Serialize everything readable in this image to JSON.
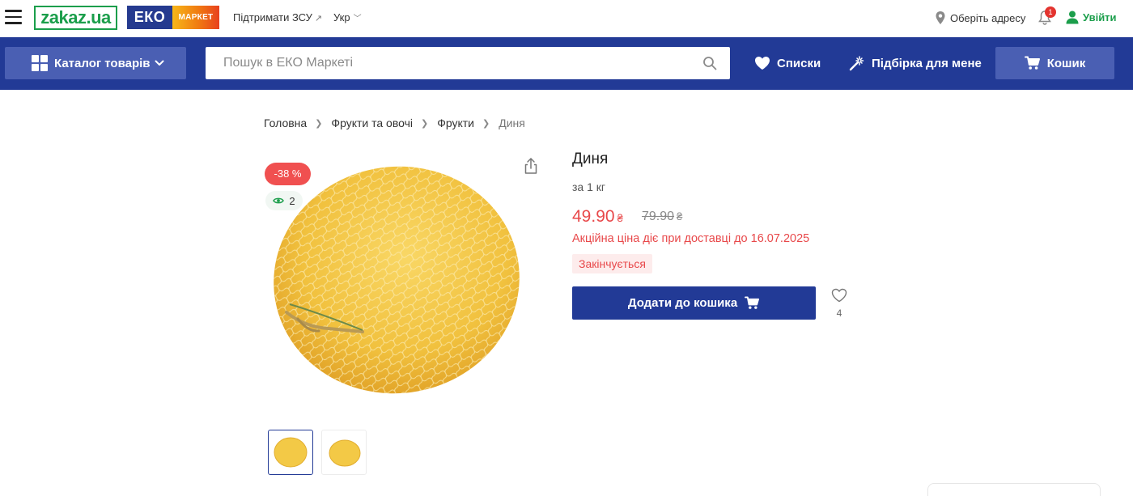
{
  "header": {
    "logo_zakaz": "zakaz.ua",
    "logo_eko": "ЕКО",
    "logo_market": "МАРКЕТ",
    "support_link": "Підтримати ЗСУ",
    "language": "Укр",
    "address": "Оберіть адресу",
    "notifications_count": "1",
    "login": "Увійти"
  },
  "nav": {
    "catalog_label": "Каталог товарів",
    "search_placeholder": "Пошук в ЕКО Маркеті",
    "lists_label": "Списки",
    "picks_label": "Підбірка для мене",
    "cart_label": "Кошик"
  },
  "breadcrumb": {
    "items": [
      "Головна",
      "Фрукти та овочі",
      "Фрукти"
    ],
    "current": "Диня"
  },
  "product": {
    "discount_badge": "-38 %",
    "views_count": "2",
    "title": "Диня",
    "unit": "за 1 кг",
    "price": "49.90",
    "old_price": "79.90",
    "currency": "₴",
    "promo_text": "Акційна ціна діє при доставці до 16.07.2025",
    "stock_badge": "Закінчується",
    "add_to_cart": "Додати до кошика",
    "favorites_count": "4"
  },
  "colors": {
    "brand_green": "#1b9e4b",
    "nav_blue": "#223a96",
    "button_blue_light": "#4a5fb3",
    "sale_red": "#e8484a"
  }
}
